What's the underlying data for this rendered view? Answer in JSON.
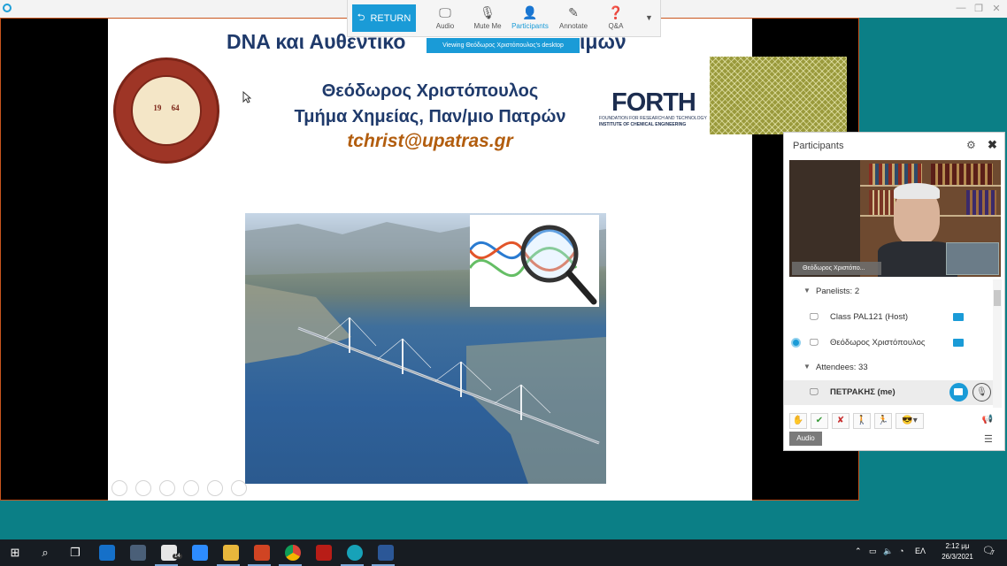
{
  "slide": {
    "title": "DNA και Αυθεντικό",
    "title_tail": "ιμών",
    "author": "Θεόδωρος Χριστόπουλος",
    "department": "Τμήμα Χημείας, Παν/μιο Πατρών",
    "email": "tchrist@upatras.gr",
    "seal": {
      "year_left": "19",
      "year_right": "64"
    },
    "forth_logo": {
      "word": "FORTH",
      "line1": "FOUNDATION FOR RESEARCH AND TECHNOLOGY",
      "line2": "INSTITUTE OF CHEMICAL ENGINEERING"
    }
  },
  "toolbar": {
    "return_label": "RETURN",
    "items": [
      {
        "label": "Audio",
        "icon": "monitor-icon"
      },
      {
        "label": "Mute Me",
        "icon": "mic-icon"
      },
      {
        "label": "Participants",
        "icon": "participants-icon"
      },
      {
        "label": "Annotate",
        "icon": "pen-icon"
      },
      {
        "label": "Q&A",
        "icon": "question-icon"
      }
    ],
    "active": "Participants",
    "viewing_text": "Viewing Θεόδωρος Χριστόπουλος's desktop"
  },
  "participants_panel": {
    "title": "Participants",
    "video_name_label": "Θεόδωρος Χριστόπο...",
    "panelists_label": "Panelists: 2",
    "panelists": [
      {
        "name": "Class PAL121 (Host)"
      },
      {
        "name": "Θεόδωρος Χριστόπουλος"
      }
    ],
    "attendees_label": "Attendees: 33",
    "me": {
      "name": "ΠΕΤΡΑΚΗΣ (me)"
    },
    "audio_tooltip": "Audio"
  },
  "taskbar": {
    "mail_badge": "14",
    "language": "ΕΛ",
    "time": "2:12 μμ",
    "date": "26/3/2021",
    "notifications": "7"
  },
  "colors": {
    "accent": "#1a9bd7",
    "desktop": "#0b7f86",
    "slide_title": "#1f3a6b",
    "email": "#b25d0e"
  }
}
